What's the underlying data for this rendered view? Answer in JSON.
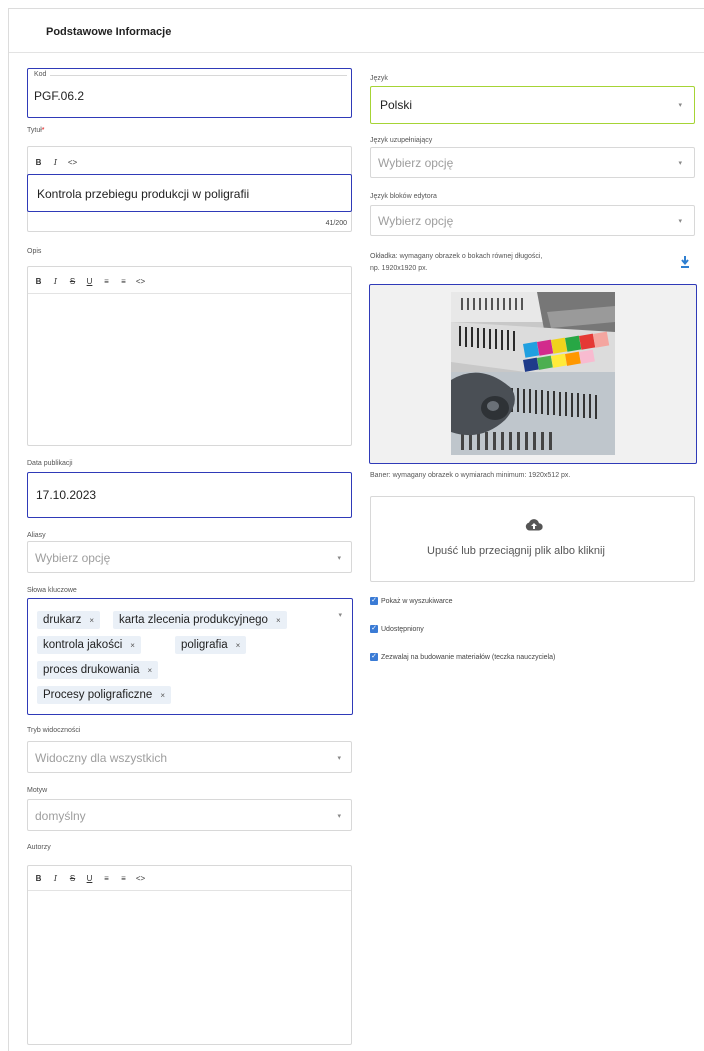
{
  "section_title": "Podstawowe Informacje",
  "left": {
    "kod": {
      "label": "Kod",
      "value": "PGF.06.2"
    },
    "tytul": {
      "label": "Tytuł",
      "required_mark": "*",
      "value": "Kontrola przebiegu produkcji w poligrafii",
      "counter": "41/200"
    },
    "opis": {
      "label": "Opis"
    },
    "data_publikacji": {
      "label": "Data publikacji",
      "value": "17.10.2023"
    },
    "aliasy": {
      "label": "Aliasy",
      "placeholder": "Wybierz opcję"
    },
    "slowa_kluczowe": {
      "label": "Słowa kluczowe",
      "chips": [
        "drukarz",
        "karta zlecenia produkcyjnego",
        "kontrola jakości",
        "poligrafia",
        "proces drukowania",
        "Procesy poligraficzne"
      ]
    },
    "tryb_widocznosci": {
      "label": "Tryb widoczności",
      "value": "Widoczny dla wszystkich"
    },
    "motyw": {
      "label": "Motyw",
      "value": "domyślny"
    },
    "autorzy": {
      "label": "Autorzy"
    }
  },
  "right": {
    "jezyk": {
      "label": "Język",
      "value": "Polski"
    },
    "jezyk_uzupelniajacy": {
      "label": "Język uzupełniający",
      "placeholder": "Wybierz opcję"
    },
    "jezyk_blokow": {
      "label": "Język bloków edytora",
      "placeholder": "Wybierz opcję"
    },
    "okladka": {
      "label_line1": "Okładka: wymagany obrazek o bokach równej długości,",
      "label_line2": "np. 1920x1920 px."
    },
    "baner": {
      "label": "Baner: wymagany obrazek o wymiarach minimum: 1920x512 px.",
      "dropzone_text": "Upuść lub przeciągnij plik albo kliknij"
    },
    "checkboxes": [
      "Pokaż w wyszukiwarce",
      "Udostępniony",
      "Zezwalaj na budowanie materiałów (teczka nauczyciela)"
    ]
  },
  "toolbar_short": [
    "B",
    "I",
    "<>"
  ],
  "toolbar_full": [
    "B",
    "I",
    "S",
    "U",
    "≡",
    "≡",
    "<>"
  ],
  "caret_glyph": "▾",
  "chip_remove_glyph": "×",
  "check_glyph": "✓",
  "colors": {
    "highlight": "#2f3ab8",
    "highlight_green": "#a6d435",
    "chip_bg": "#eaf0f7",
    "checkbox": "#3a7bd5",
    "download_icon": "#2f7fd0"
  }
}
